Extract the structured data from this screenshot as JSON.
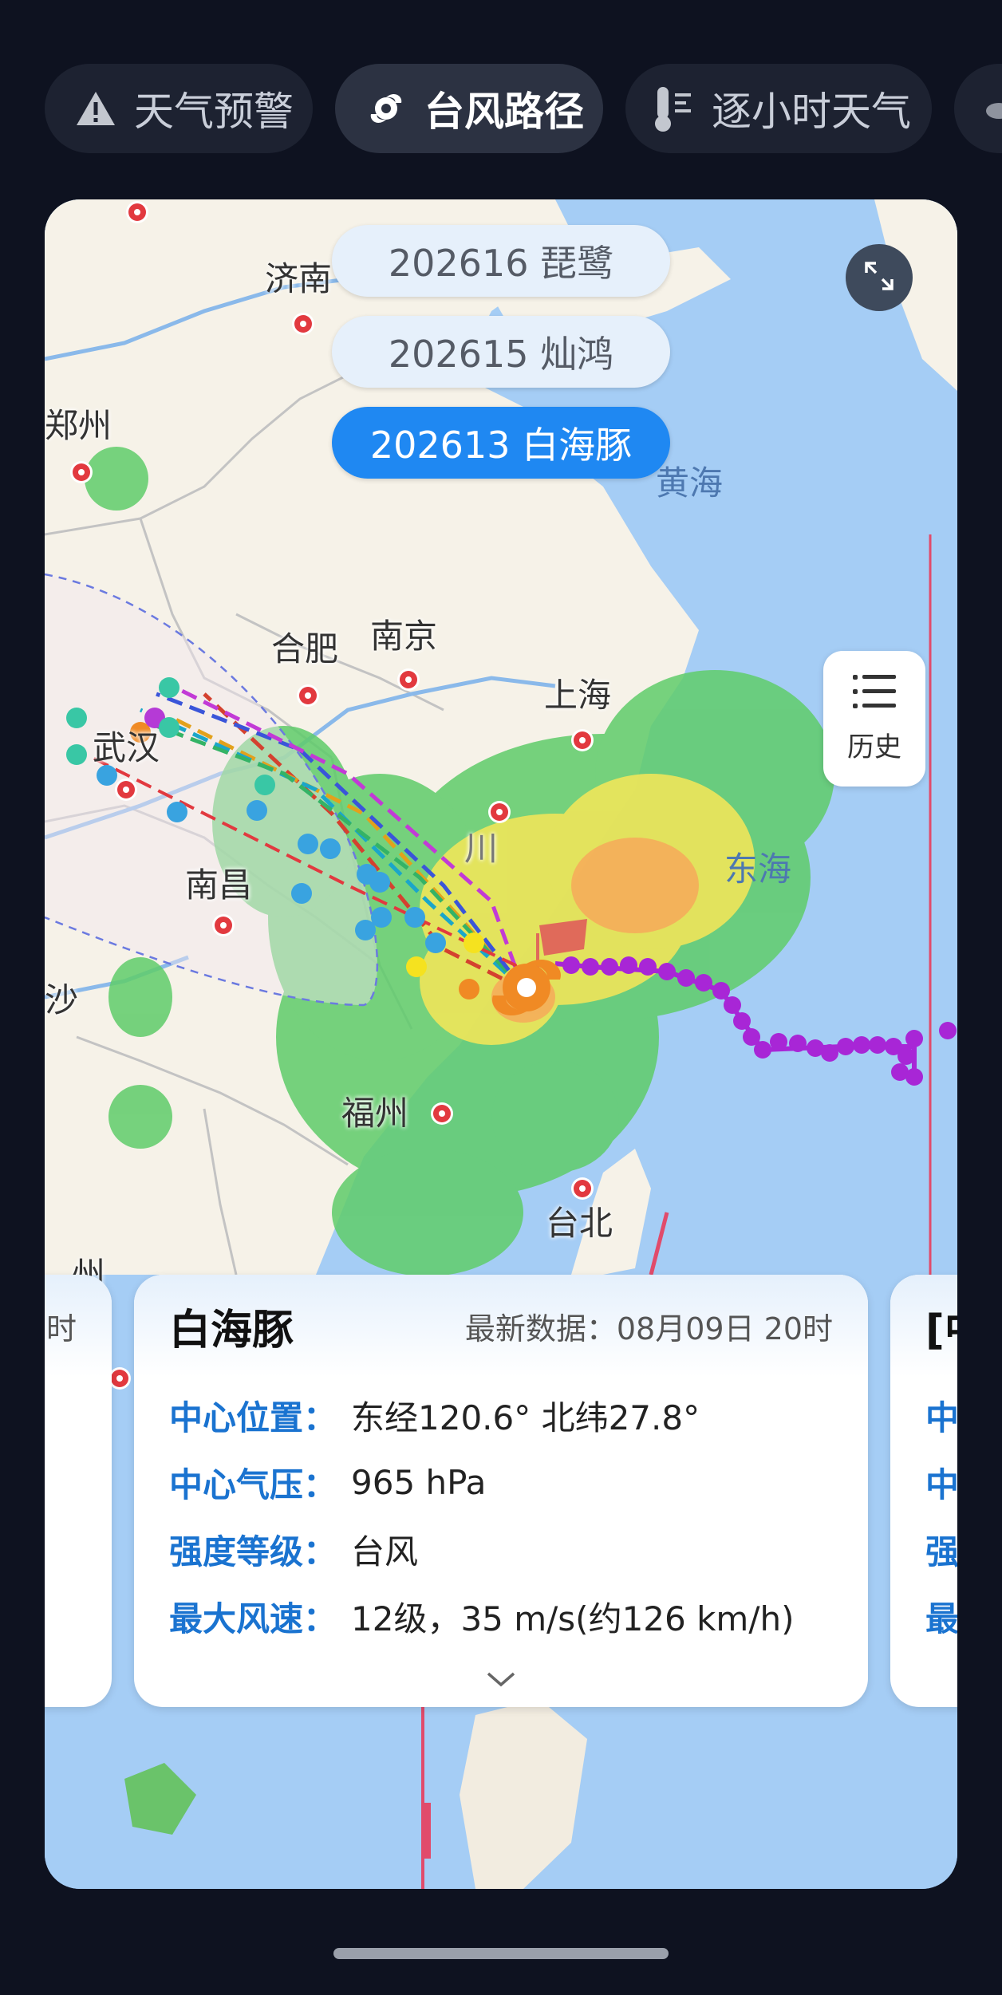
{
  "tabs": [
    {
      "label": "天气预警",
      "icon": "warning-icon"
    },
    {
      "label": "台风路径",
      "icon": "typhoon-icon"
    },
    {
      "label": "逐小时天气",
      "icon": "thermometer-icon"
    }
  ],
  "map": {
    "cities": [
      "济南",
      "郑州",
      "合肥",
      "南京",
      "上海",
      "武汉",
      "南昌",
      "福州",
      "台北"
    ],
    "seas": [
      "黄海",
      "东海"
    ],
    "partial_labels": [
      "沙",
      "州",
      "川"
    ],
    "typhoon_list": [
      "202616 琵鹭",
      "202615 灿鸿",
      "202613 白海豚"
    ],
    "history_label": "历史"
  },
  "info_card": {
    "name": "白海豚",
    "latest": "最新数据：08月09日 20时",
    "rows": [
      {
        "key": "中心位置：",
        "value": "东经120.6° 北纬27.8°"
      },
      {
        "key": "中心气压：",
        "value": "965 hPa"
      },
      {
        "key": "强度等级：",
        "value": "台风"
      },
      {
        "key": "最大风速：",
        "value": "12级，35 m/s(约126 km/h)"
      }
    ]
  },
  "side_cards": {
    "left_head": "时",
    "right_head": "[中",
    "right_rows": [
      "中",
      "中",
      "强",
      "最"
    ]
  },
  "colors": {
    "accent": "#1f88f2",
    "track": "#a826d6",
    "label_blue": "#1a73d0"
  }
}
